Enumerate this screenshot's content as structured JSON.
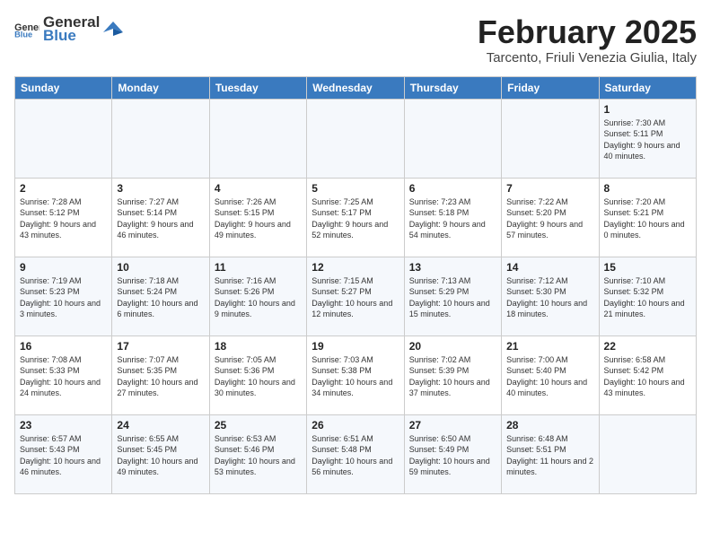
{
  "header": {
    "logo_general": "General",
    "logo_blue": "Blue",
    "title": "February 2025",
    "subtitle": "Tarcento, Friuli Venezia Giulia, Italy"
  },
  "days_of_week": [
    "Sunday",
    "Monday",
    "Tuesday",
    "Wednesday",
    "Thursday",
    "Friday",
    "Saturday"
  ],
  "weeks": [
    [
      {
        "day": "",
        "info": ""
      },
      {
        "day": "",
        "info": ""
      },
      {
        "day": "",
        "info": ""
      },
      {
        "day": "",
        "info": ""
      },
      {
        "day": "",
        "info": ""
      },
      {
        "day": "",
        "info": ""
      },
      {
        "day": "1",
        "info": "Sunrise: 7:30 AM\nSunset: 5:11 PM\nDaylight: 9 hours and 40 minutes."
      }
    ],
    [
      {
        "day": "2",
        "info": "Sunrise: 7:28 AM\nSunset: 5:12 PM\nDaylight: 9 hours and 43 minutes."
      },
      {
        "day": "3",
        "info": "Sunrise: 7:27 AM\nSunset: 5:14 PM\nDaylight: 9 hours and 46 minutes."
      },
      {
        "day": "4",
        "info": "Sunrise: 7:26 AM\nSunset: 5:15 PM\nDaylight: 9 hours and 49 minutes."
      },
      {
        "day": "5",
        "info": "Sunrise: 7:25 AM\nSunset: 5:17 PM\nDaylight: 9 hours and 52 minutes."
      },
      {
        "day": "6",
        "info": "Sunrise: 7:23 AM\nSunset: 5:18 PM\nDaylight: 9 hours and 54 minutes."
      },
      {
        "day": "7",
        "info": "Sunrise: 7:22 AM\nSunset: 5:20 PM\nDaylight: 9 hours and 57 minutes."
      },
      {
        "day": "8",
        "info": "Sunrise: 7:20 AM\nSunset: 5:21 PM\nDaylight: 10 hours and 0 minutes."
      }
    ],
    [
      {
        "day": "9",
        "info": "Sunrise: 7:19 AM\nSunset: 5:23 PM\nDaylight: 10 hours and 3 minutes."
      },
      {
        "day": "10",
        "info": "Sunrise: 7:18 AM\nSunset: 5:24 PM\nDaylight: 10 hours and 6 minutes."
      },
      {
        "day": "11",
        "info": "Sunrise: 7:16 AM\nSunset: 5:26 PM\nDaylight: 10 hours and 9 minutes."
      },
      {
        "day": "12",
        "info": "Sunrise: 7:15 AM\nSunset: 5:27 PM\nDaylight: 10 hours and 12 minutes."
      },
      {
        "day": "13",
        "info": "Sunrise: 7:13 AM\nSunset: 5:29 PM\nDaylight: 10 hours and 15 minutes."
      },
      {
        "day": "14",
        "info": "Sunrise: 7:12 AM\nSunset: 5:30 PM\nDaylight: 10 hours and 18 minutes."
      },
      {
        "day": "15",
        "info": "Sunrise: 7:10 AM\nSunset: 5:32 PM\nDaylight: 10 hours and 21 minutes."
      }
    ],
    [
      {
        "day": "16",
        "info": "Sunrise: 7:08 AM\nSunset: 5:33 PM\nDaylight: 10 hours and 24 minutes."
      },
      {
        "day": "17",
        "info": "Sunrise: 7:07 AM\nSunset: 5:35 PM\nDaylight: 10 hours and 27 minutes."
      },
      {
        "day": "18",
        "info": "Sunrise: 7:05 AM\nSunset: 5:36 PM\nDaylight: 10 hours and 30 minutes."
      },
      {
        "day": "19",
        "info": "Sunrise: 7:03 AM\nSunset: 5:38 PM\nDaylight: 10 hours and 34 minutes."
      },
      {
        "day": "20",
        "info": "Sunrise: 7:02 AM\nSunset: 5:39 PM\nDaylight: 10 hours and 37 minutes."
      },
      {
        "day": "21",
        "info": "Sunrise: 7:00 AM\nSunset: 5:40 PM\nDaylight: 10 hours and 40 minutes."
      },
      {
        "day": "22",
        "info": "Sunrise: 6:58 AM\nSunset: 5:42 PM\nDaylight: 10 hours and 43 minutes."
      }
    ],
    [
      {
        "day": "23",
        "info": "Sunrise: 6:57 AM\nSunset: 5:43 PM\nDaylight: 10 hours and 46 minutes."
      },
      {
        "day": "24",
        "info": "Sunrise: 6:55 AM\nSunset: 5:45 PM\nDaylight: 10 hours and 49 minutes."
      },
      {
        "day": "25",
        "info": "Sunrise: 6:53 AM\nSunset: 5:46 PM\nDaylight: 10 hours and 53 minutes."
      },
      {
        "day": "26",
        "info": "Sunrise: 6:51 AM\nSunset: 5:48 PM\nDaylight: 10 hours and 56 minutes."
      },
      {
        "day": "27",
        "info": "Sunrise: 6:50 AM\nSunset: 5:49 PM\nDaylight: 10 hours and 59 minutes."
      },
      {
        "day": "28",
        "info": "Sunrise: 6:48 AM\nSunset: 5:51 PM\nDaylight: 11 hours and 2 minutes."
      },
      {
        "day": "",
        "info": ""
      }
    ]
  ]
}
